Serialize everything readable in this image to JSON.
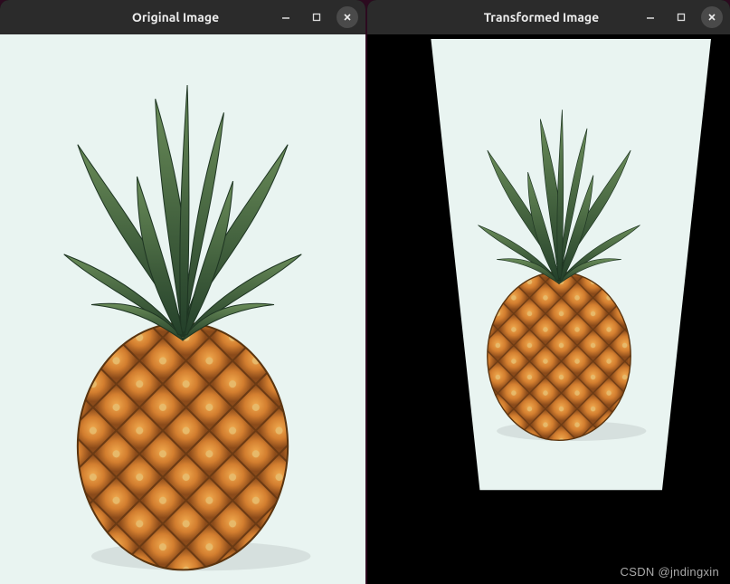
{
  "windows": {
    "left": {
      "title": "Original Image",
      "controls": {
        "minimize": "minimize",
        "maximize": "maximize",
        "close": "close"
      }
    },
    "right": {
      "title": "Transformed Image",
      "controls": {
        "minimize": "minimize",
        "maximize": "maximize",
        "close": "close"
      }
    }
  },
  "watermark": "CSDN @jndingxin",
  "content": {
    "subject": "pineapple",
    "background_color": "#e9f4f1"
  }
}
